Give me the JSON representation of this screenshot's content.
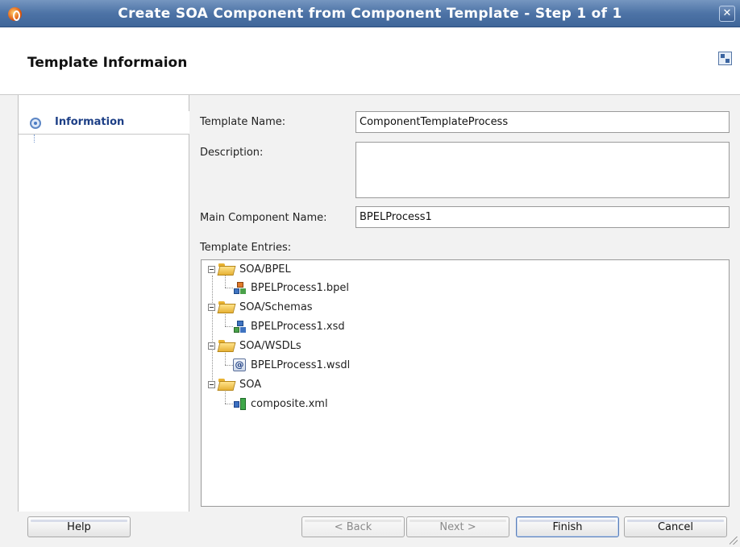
{
  "window": {
    "title": "Create SOA Component from Component Template - Step 1 of 1",
    "close_glyph": "✕"
  },
  "header": {
    "title": "Template Informaion"
  },
  "nav": {
    "items": [
      {
        "label": "Information"
      }
    ]
  },
  "form": {
    "template_name_label": "Template Name:",
    "template_name_value": "ComponentTemplateProcess",
    "description_label": "Description:",
    "description_value": "",
    "main_component_label": "Main Component Name:",
    "main_component_value": "BPELProcess1",
    "entries_label": "Template Entries:"
  },
  "tree": {
    "folders": [
      {
        "label": "SOA/BPEL",
        "child": {
          "label": "BPELProcess1.bpel",
          "icon": "bpel-process-icon"
        }
      },
      {
        "label": "SOA/Schemas",
        "child": {
          "label": "BPELProcess1.xsd",
          "icon": "xsd-schema-icon"
        }
      },
      {
        "label": "SOA/WSDLs",
        "child": {
          "label": "BPELProcess1.wsdl",
          "icon": "wsdl-icon"
        }
      },
      {
        "label": "SOA",
        "child": {
          "label": "composite.xml",
          "icon": "composite-icon"
        }
      }
    ]
  },
  "buttons": {
    "help": "Help",
    "back": "< Back",
    "next": "Next >",
    "finish": "Finish",
    "cancel": "Cancel"
  },
  "colors": {
    "titlebar": "#4d73a6",
    "nav_label": "#1d3f86",
    "panel_bg": "#f2f2f2"
  }
}
